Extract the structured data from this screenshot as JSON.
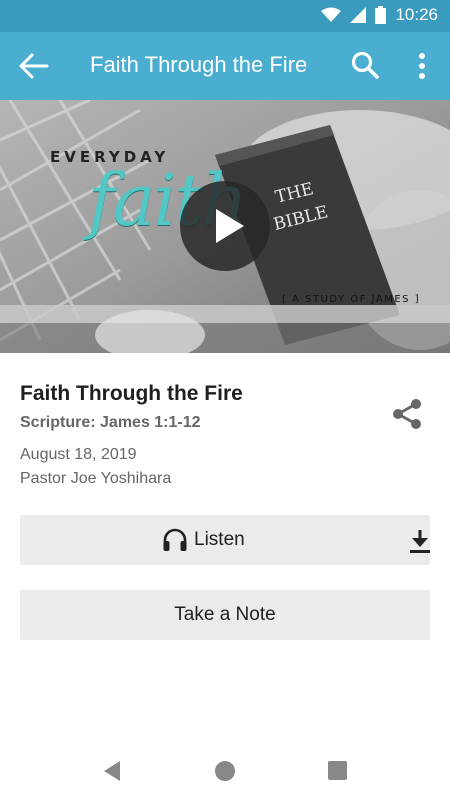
{
  "status_bar": {
    "time": "10:26",
    "icons": [
      "wifi-icon",
      "cell-signal-icon",
      "battery-icon"
    ]
  },
  "app_bar": {
    "title": "Faith Through the Fire",
    "back_icon": "arrow-back-icon",
    "search_icon": "search-icon",
    "more_icon": "more-vert-icon"
  },
  "hero": {
    "kicker": "EVERYDAY",
    "script": "faith",
    "book_title_line1": "THE",
    "book_title_line2": "BIBLE",
    "series": "[ A STUDY OF JAMES ]",
    "play_icon": "play-icon"
  },
  "sermon": {
    "title": "Faith Through the Fire",
    "scripture": "Scripture: James 1:1-12",
    "date": "August 18, 2019",
    "speaker": "Pastor Joe Yoshihara"
  },
  "actions": {
    "listen_label": "Listen",
    "note_label": "Take a Note"
  },
  "colors": {
    "status_bar": "#3a9bbf",
    "app_bar": "#4aaed1",
    "button_bg": "#ebebeb",
    "script_accent": "#52c7c5"
  }
}
